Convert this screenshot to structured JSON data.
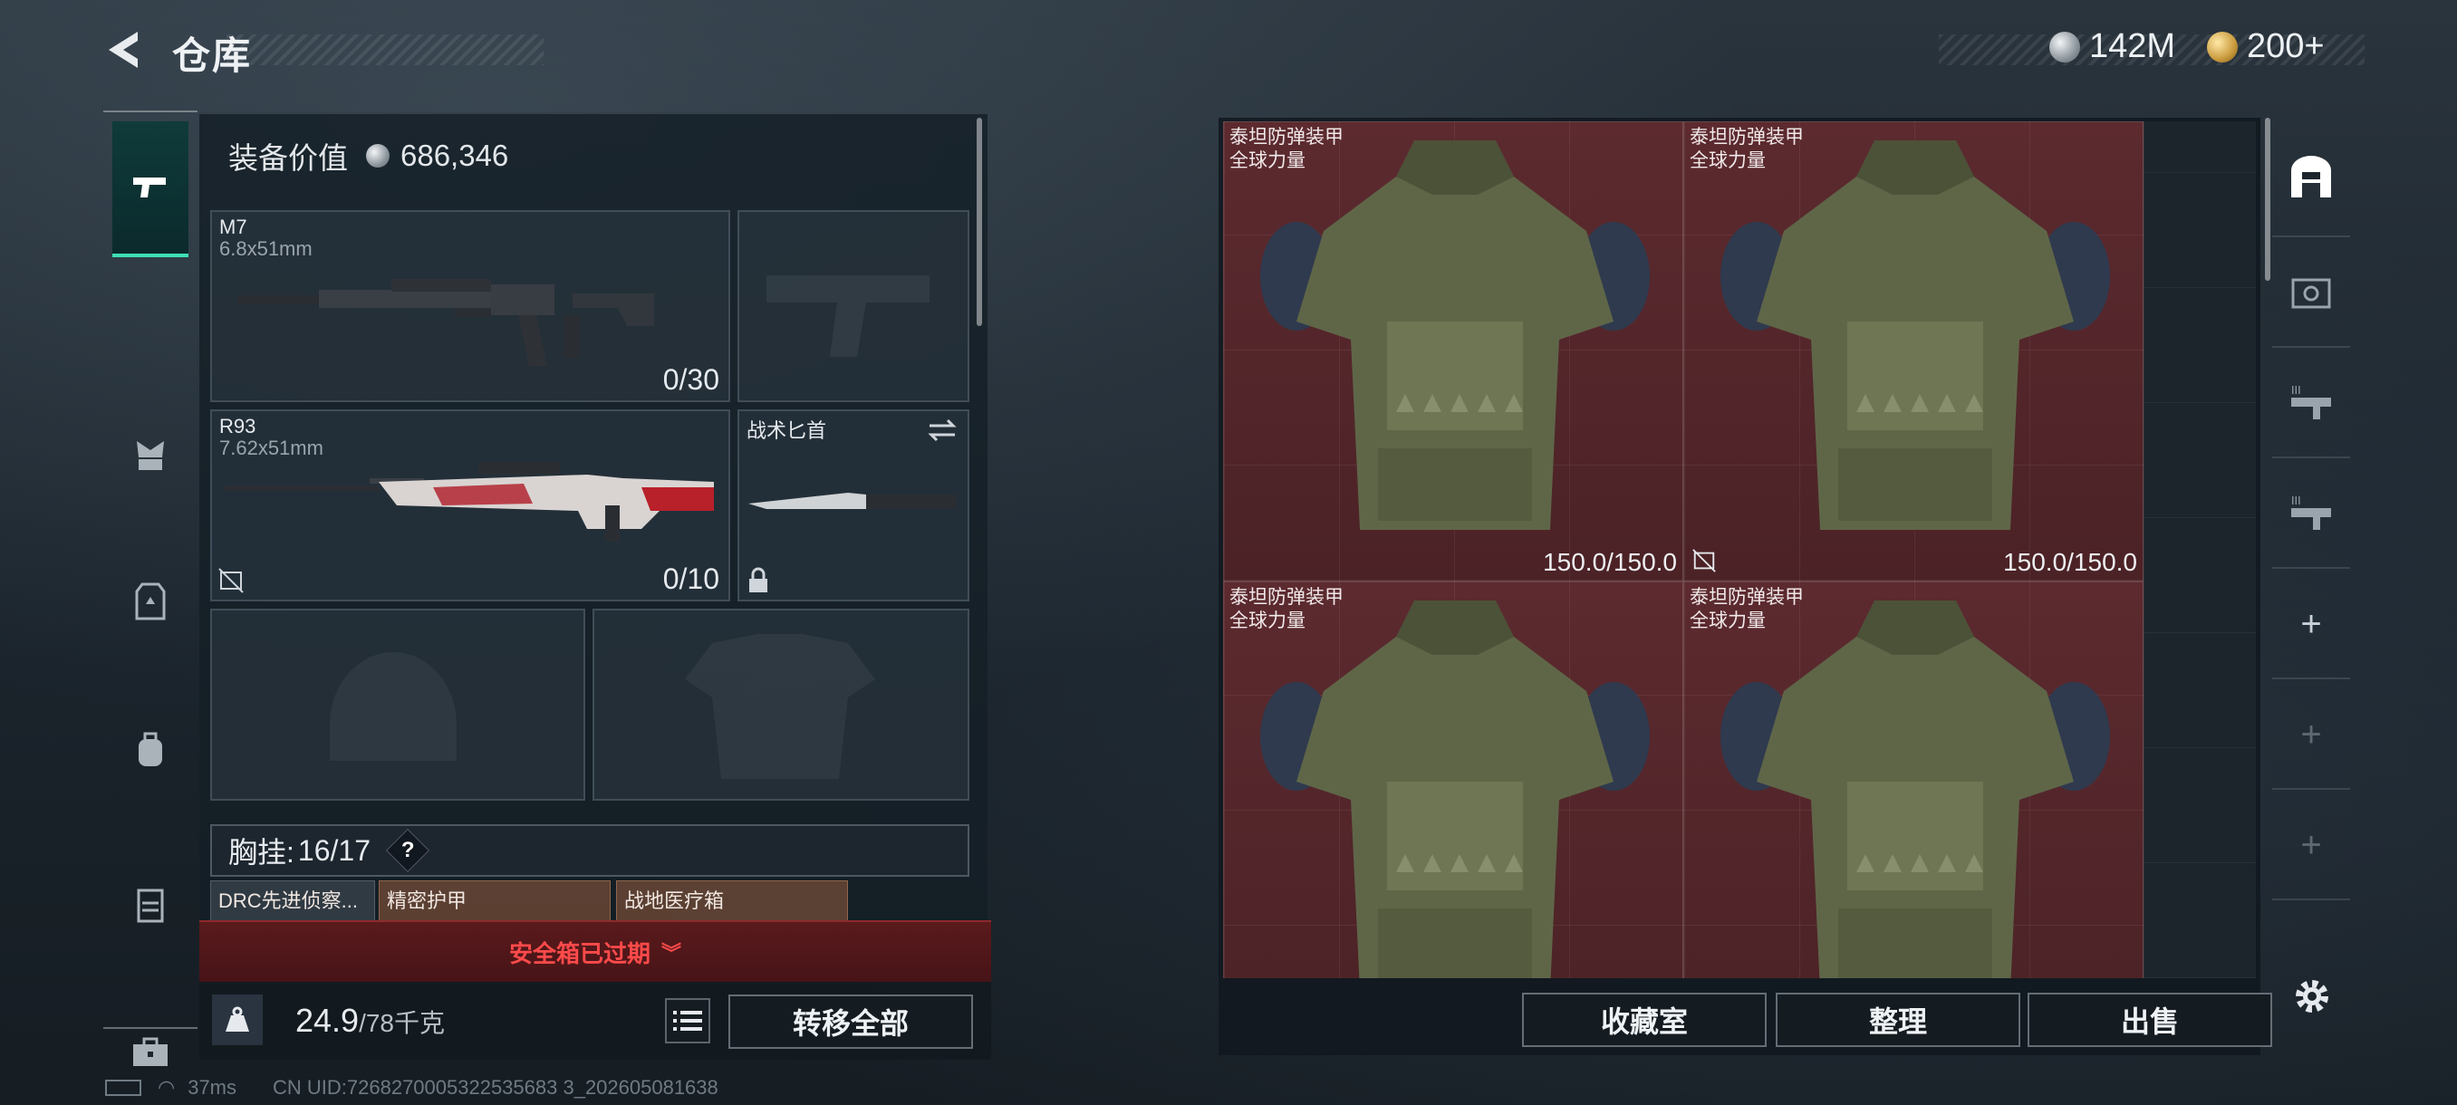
{
  "header": {
    "title": "仓库",
    "currencies": [
      {
        "icon": "silver-coin-icon",
        "value": "142M"
      },
      {
        "icon": "gold-coin-icon",
        "value": "200+"
      }
    ]
  },
  "left_rail": [
    {
      "name": "weapons",
      "icon": "pistol-icon",
      "active": true
    },
    {
      "name": "helmet",
      "icon": "helmet-icon"
    },
    {
      "name": "armor",
      "icon": "armor-icon"
    },
    {
      "name": "backpack",
      "icon": "backpack-icon"
    },
    {
      "name": "chest-rig",
      "icon": "chest-rig-icon"
    },
    {
      "name": "toolbox",
      "icon": "toolbox-icon"
    }
  ],
  "equipment": {
    "value_label": "装备价值",
    "value": "686,346",
    "primary": {
      "name": "M7",
      "caliber": "6.8x51mm",
      "ammo": "0/30"
    },
    "secondary": {
      "name": "R93",
      "caliber": "7.62x51mm",
      "ammo": "0/10"
    },
    "melee": {
      "name": "战术匕首"
    },
    "chest_rig": {
      "label": "胸挂:",
      "count": "16/17",
      "help": "?"
    },
    "rig_items": [
      "DRC先进侦察...",
      "精密护甲",
      "战地医疗箱"
    ]
  },
  "safe_box": {
    "text": "安全箱已过期"
  },
  "weight": {
    "value": "24.9",
    "max": "/78千克"
  },
  "buttons": {
    "transfer_all": "转移全部",
    "collection": "收藏室",
    "organize": "整理",
    "sell": "出售"
  },
  "stash": {
    "items": [
      {
        "name": "泰坦防弹装甲",
        "sub": "全球力量",
        "durability": "150.0/150.0",
        "no_sell": false
      },
      {
        "name": "泰坦防弹装甲",
        "sub": "全球力量",
        "durability": "150.0/150.0",
        "no_sell": true
      },
      {
        "name": "泰坦防弹装甲",
        "sub": "全球力量",
        "durability": "",
        "no_sell": false
      },
      {
        "name": "泰坦防弹装甲",
        "sub": "全球力量",
        "durability": "",
        "no_sell": false
      }
    ]
  },
  "status": {
    "ping": "37ms",
    "uid": "CN UID:7268270005322535683 3_202605081638"
  },
  "colors": {
    "accent": "#3ee0b5",
    "alert": "#ff4a4a",
    "item_bg": "#5c2a2f"
  }
}
